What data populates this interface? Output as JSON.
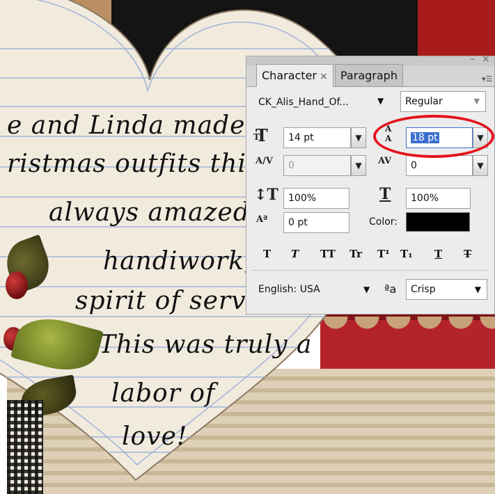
{
  "note": {
    "lines": [
      "e and Linda made t",
      "ristmas outfits this y",
      "always amazed",
      "handiwork,",
      "spirit of servan",
      "This was truly a",
      "labor of",
      "love!"
    ]
  },
  "panel": {
    "tabs": [
      {
        "label": "Character",
        "close": "×"
      },
      {
        "label": "Paragraph"
      }
    ],
    "window_buttons": {
      "minimize": "–",
      "close": "×"
    },
    "font_family": "CK_Alis_Hand_Of...",
    "font_style": "Regular",
    "font_size": "14 pt",
    "leading": "18 pt",
    "kerning": "0",
    "tracking": "0",
    "vertical_scale": "100%",
    "horizontal_scale": "100%",
    "baseline_shift": "0 pt",
    "color_label": "Color:",
    "text_color": "#000000",
    "style_buttons": [
      "T",
      "T",
      "TT",
      "Tr",
      "T¹",
      "T₁",
      "T",
      "T"
    ],
    "language": "English: USA",
    "antialias_icon": "ªa",
    "antialias": "Crisp"
  },
  "colors": {
    "highlight": "#e4121b",
    "selection": "#3a6fcf"
  }
}
